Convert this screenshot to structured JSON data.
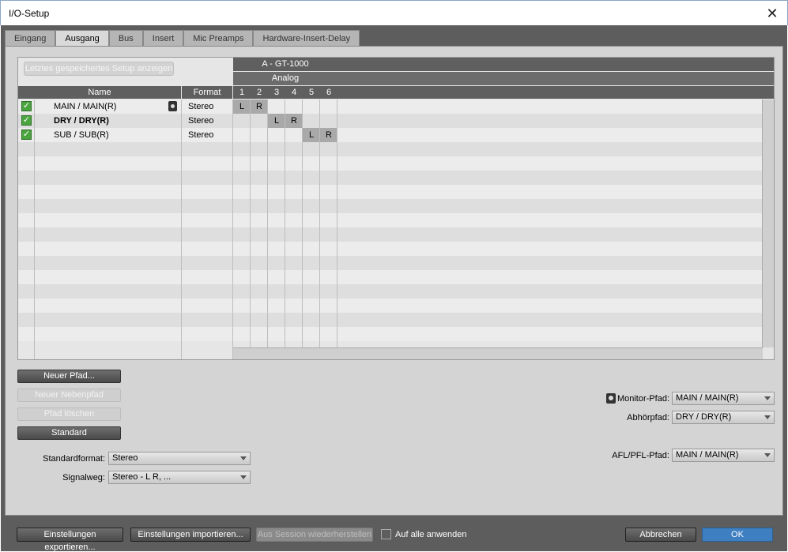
{
  "window": {
    "title": "I/O-Setup",
    "close_glyph": "✕"
  },
  "tabs": [
    "Eingang",
    "Ausgang",
    "Bus",
    "Insert",
    "Mic Preamps",
    "Hardware-Insert-Delay"
  ],
  "active_tab": "Ausgang",
  "grid": {
    "last_setup_button": "Letztes gespeichertes Setup anzeigen",
    "device_header": "A - GT-1000",
    "group_header": "Analog",
    "col_name": "Name",
    "col_format": "Format",
    "channels": [
      "1",
      "2",
      "3",
      "4",
      "5",
      "6"
    ],
    "rows": [
      {
        "name": "MAIN / MAIN(R)",
        "format": "Stereo",
        "checked": true,
        "bold": false,
        "monitor_icon": true,
        "assign": [
          {
            "ch": 1,
            "label": "L"
          },
          {
            "ch": 2,
            "label": "R"
          }
        ]
      },
      {
        "name": "DRY / DRY(R)",
        "format": "Stereo",
        "checked": true,
        "bold": true,
        "monitor_icon": false,
        "assign": [
          {
            "ch": 3,
            "label": "L"
          },
          {
            "ch": 4,
            "label": "R"
          }
        ]
      },
      {
        "name": "SUB / SUB(R)",
        "format": "Stereo",
        "checked": true,
        "bold": false,
        "monitor_icon": false,
        "assign": [
          {
            "ch": 5,
            "label": "L"
          },
          {
            "ch": 6,
            "label": "R"
          }
        ]
      }
    ]
  },
  "buttons": {
    "new_path": "Neuer Pfad...",
    "new_subpath": "Neuer Nebenpfad",
    "delete_path": "Pfad löschen",
    "default": "Standard"
  },
  "standard_format": {
    "label": "Standardformat:",
    "value": "Stereo"
  },
  "signal_path": {
    "label": "Signalweg:",
    "value": "Stereo - L R, ..."
  },
  "monitor_path": {
    "label": "Monitor-Pfad:",
    "value": "MAIN / MAIN(R)"
  },
  "listen_path": {
    "label": "Abhörpfad:",
    "value": "DRY / DRY(R)"
  },
  "afl_pfl_path": {
    "label": "AFL/PFL-Pfad:",
    "value": "MAIN / MAIN(R)"
  },
  "footer": {
    "export": "Einstellungen exportieren...",
    "import": "Einstellungen importieren...",
    "restore": "Aus Session wiederherstellen",
    "apply_all": "Auf alle anwenden",
    "cancel": "Abbrechen",
    "ok": "OK"
  },
  "colors": {
    "accent_ok": "#3d7fc1",
    "check_green": "#4aa53f"
  }
}
